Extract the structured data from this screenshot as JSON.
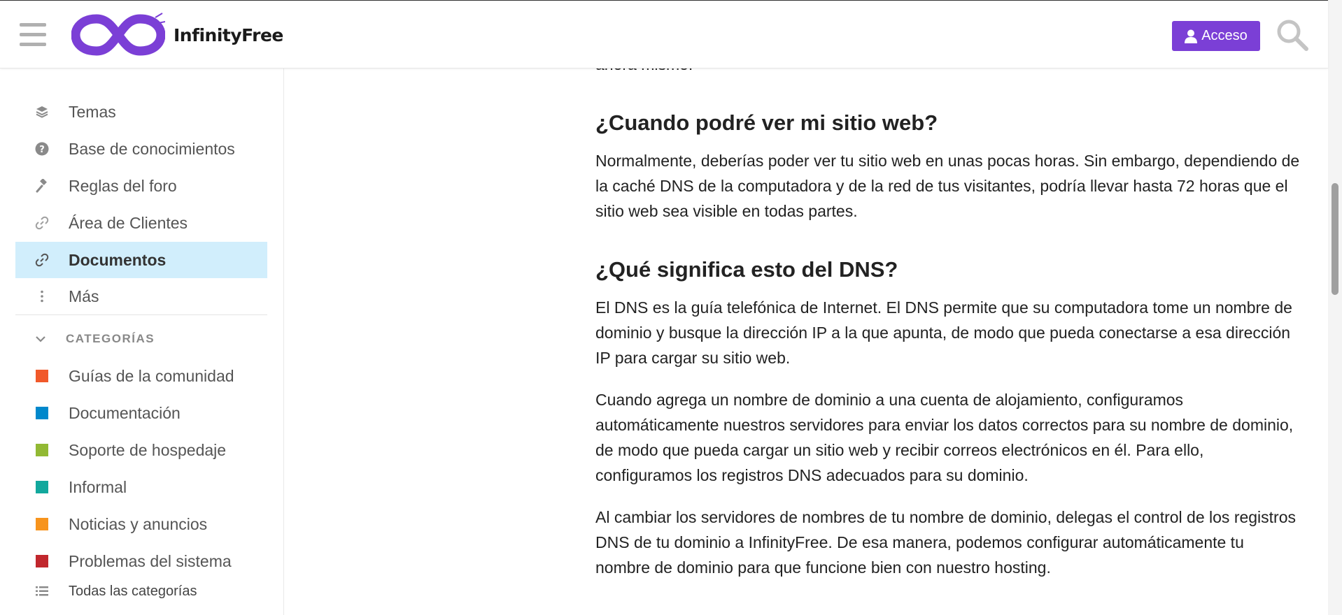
{
  "header": {
    "brand": "InfinityFree",
    "login_label": "Acceso",
    "brand_color": "#7b3fd6"
  },
  "sidebar": {
    "items": [
      {
        "label": "Temas",
        "icon": "layers-icon"
      },
      {
        "label": "Base de conocimientos",
        "icon": "question-circle-icon"
      },
      {
        "label": "Reglas del foro",
        "icon": "gavel-icon"
      },
      {
        "label": "Área de Clientes",
        "icon": "link-icon"
      },
      {
        "label": "Documentos",
        "icon": "link-icon",
        "active": true
      },
      {
        "label": "Más",
        "icon": "ellipsis-vertical-icon"
      }
    ],
    "categories_label": "CATEGORÍAS",
    "categories": [
      {
        "label": "Guías de la comunidad",
        "color": "#f1592a"
      },
      {
        "label": "Documentación",
        "color": "#0088cc"
      },
      {
        "label": "Soporte de hospedaje",
        "color": "#92b934"
      },
      {
        "label": "Informal",
        "color": "#12a89d"
      },
      {
        "label": "Noticias y anuncios",
        "color": "#f7941d"
      },
      {
        "label": "Problemas del sistema",
        "color": "#c1272d"
      }
    ],
    "all_categories_label": "Todas las categorías"
  },
  "article": {
    "cut_text": "ahora mismo.",
    "h1": "¿Cuando podré ver mi sitio web?",
    "p1": "Normalmente, deberías poder ver tu sitio web en unas pocas horas. Sin embargo, dependiendo de la caché DNS de la computadora y de la red de tus visitantes, podría llevar hasta 72 horas que el sitio web sea visible en todas partes.",
    "h2": "¿Qué significa esto del DNS?",
    "p2": "El DNS es la guía telefónica de Internet. El DNS permite que su computadora tome un nombre de dominio y busque la dirección IP a la que apunta, de modo que pueda conectarse a esa dirección IP para cargar su sitio web.",
    "p3": "Cuando agrega un nombre de dominio a una cuenta de alojamiento, configuramos automáticamente nuestros servidores para enviar los datos correctos para su nombre de dominio, de modo que pueda cargar un sitio web y recibir correos electrónicos en él. Para ello, configuramos los registros DNS adecuados para su dominio.",
    "p4": "Al cambiar los servidores de nombres de tu nombre de dominio, delegas el control de los registros DNS de tu dominio a InfinityFree. De esa manera, podemos configurar automáticamente tu nombre de dominio para que funcione bien con nuestro hosting."
  }
}
